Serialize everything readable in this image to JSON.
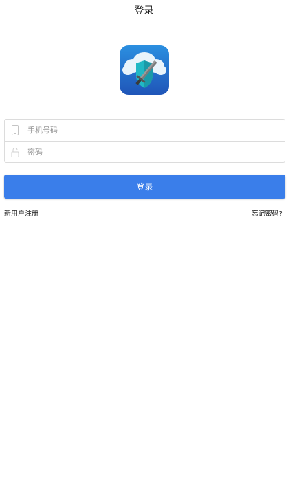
{
  "header": {
    "title": "登录"
  },
  "logo": {
    "icon": "app-logo-shield-sword-cloud",
    "colors": {
      "background_top": "#2b8fe0",
      "background_bottom": "#1f55b8",
      "cloud": "#e9f4fb",
      "shield": "#21b8c4",
      "sword": "#8a8a8a"
    }
  },
  "form": {
    "phone": {
      "icon": "phone-icon",
      "placeholder": "手机号码",
      "value": ""
    },
    "password": {
      "icon": "lock-icon",
      "placeholder": "密码",
      "value": ""
    }
  },
  "actions": {
    "login_label": "登录",
    "register_label": "新用户注册",
    "forgot_label": "忘记密码?"
  },
  "colors": {
    "accent": "#3a7eea",
    "border": "#dcdcdc"
  }
}
